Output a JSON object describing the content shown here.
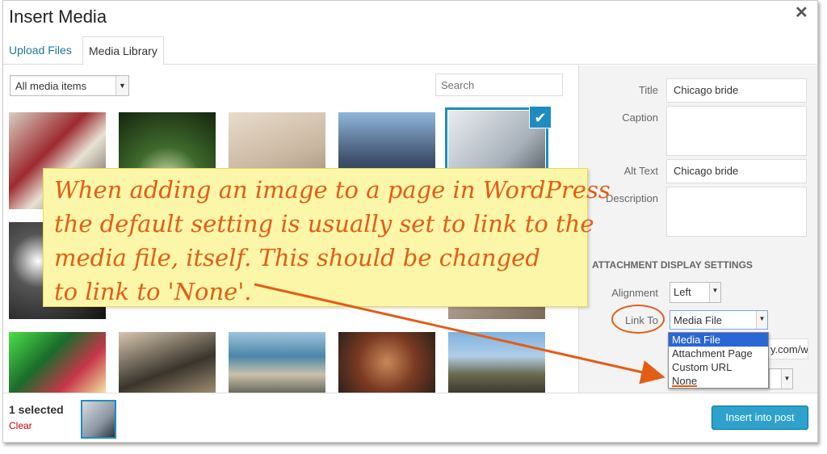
{
  "window": {
    "title": "Insert Media",
    "close_icon": "close-icon"
  },
  "tabs": [
    {
      "label": "Upload Files"
    },
    {
      "label": "Media Library"
    }
  ],
  "toolbar": {
    "filter_value": "All media items",
    "search_placeholder": "Search"
  },
  "details": {
    "title_label": "Title",
    "title_value": "Chicago bride",
    "caption_label": "Caption",
    "caption_value": "",
    "alt_label": "Alt Text",
    "alt_value": "Chicago bride",
    "description_label": "Description",
    "description_value": ""
  },
  "display_settings": {
    "heading": "ATTACHMENT DISPLAY SETTINGS",
    "alignment_label": "Alignment",
    "alignment_value": "Left",
    "linkto_label": "Link To",
    "linkto_value": "Media File",
    "linkto_options": [
      "Media File",
      "Attachment Page",
      "Custom URL",
      "None"
    ],
    "url_partial": "y.com/w"
  },
  "annotation": {
    "lines": [
      "When adding an image to a page in WordPress",
      "the default setting is usually set to link to the",
      "media file, itself. This should be changed",
      "to link to 'None'."
    ]
  },
  "footer": {
    "selected_text": "1 selected",
    "clear_label": "Clear",
    "insert_button": "Insert into post"
  },
  "colors": {
    "accent": "#2ea2cc",
    "annotation": "#e25d16",
    "note_bg": "#fcf6a8"
  }
}
